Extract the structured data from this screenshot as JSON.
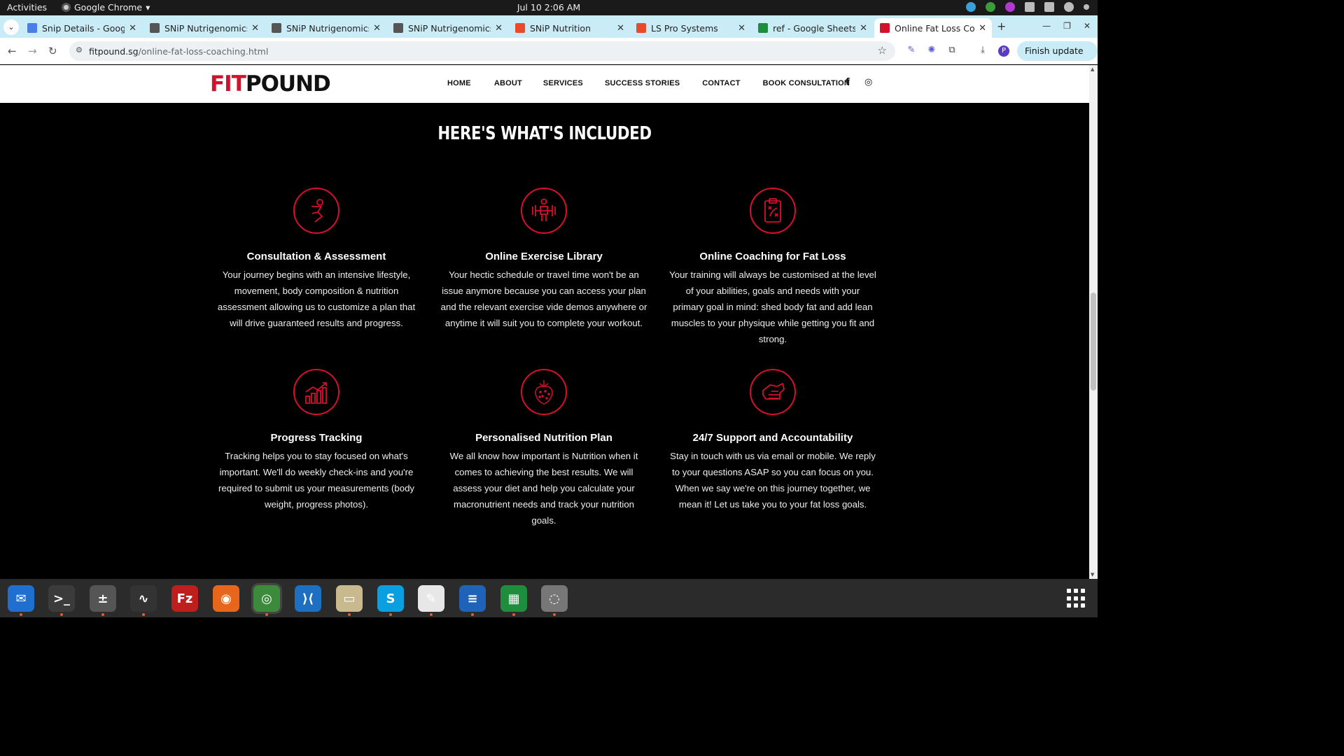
{
  "system": {
    "activities": "Activities",
    "app_name": "Google Chrome",
    "clock": "Jul 10  2:06 AM"
  },
  "tabs": [
    {
      "title": "Snip Details - Google",
      "favicon_color": "#4a7ee8",
      "active": false
    },
    {
      "title": "SNiP Nutrigenomics",
      "favicon_color": "#555555",
      "active": false
    },
    {
      "title": "SNiP Nutrigenomics",
      "favicon_color": "#555555",
      "active": false
    },
    {
      "title": "SNiP Nutrigenomics",
      "favicon_color": "#555555",
      "active": false
    },
    {
      "title": "SNiP Nutrition",
      "favicon_color": "#e84a2a",
      "active": false
    },
    {
      "title": "LS Pro Systems",
      "favicon_color": "#e84a2a",
      "active": false
    },
    {
      "title": "ref - Google Sheets",
      "favicon_color": "#1e8e3e",
      "active": false
    },
    {
      "title": "Online Fat Loss Coac",
      "favicon_color": "#d4102a",
      "active": true
    }
  ],
  "address_bar": {
    "url_host": "fitpound.sg",
    "url_path": "/online-fat-loss-coaching.html",
    "finish_update": "Finish update",
    "profile_initial": "P"
  },
  "site": {
    "logo_fit": "FIT",
    "logo_pound": "POUND",
    "nav": [
      "HOME",
      "ABOUT",
      "SERVICES",
      "SUCCESS STORIES",
      "CONTACT",
      "BOOK CONSULTATION"
    ],
    "social": {
      "facebook": "f",
      "instagram": "◎"
    },
    "accent_color": "#d4102a",
    "section_title": "HERE'S WHAT'S INCLUDED",
    "features": [
      {
        "icon": "stretching-person-icon",
        "title": "Consultation & Assessment",
        "text": "Your journey begins with an intensive lifestyle, movement, body composition & nutrition assessment allowing us to customize a plan that will drive guaranteed results and progress."
      },
      {
        "icon": "weightlifter-icon",
        "title": "Online Exercise Library",
        "text": "Your hectic schedule or travel time won't be an issue anymore because you can access your plan and the relevant exercise vide demos anywhere or anytime it will suit you to complete your workout."
      },
      {
        "icon": "clipboard-strategy-icon",
        "title": "Online Coaching for Fat Loss",
        "text": "Your training will always be customised at the level of your abilities, goals and needs with your primary goal in mind: shed body fat and add lean muscles to your physique while getting you fit and strong."
      },
      {
        "icon": "bar-chart-icon",
        "title": "Progress Tracking",
        "text": "Tracking helps you to stay focused on what's important. We'll do weekly check-ins and you're required to submit us your measurements (body weight, progress photos)."
      },
      {
        "icon": "strawberry-icon",
        "title": "Personalised Nutrition Plan",
        "text": "We all know how important is Nutrition when it comes to achieving the best results. We will assess your diet and help you calculate your macronutrient needs and track your nutrition goals."
      },
      {
        "icon": "fist-icon",
        "title": "24/7 Support and Accountability",
        "text": "Stay in touch with us via email or mobile. We reply to your questions ASAP so you can focus on you. When we say we're on this journey together, we mean it! Let us take you to your fat loss goals."
      }
    ]
  },
  "dock": [
    {
      "name": "thunderbird-icon",
      "color": "#1f6fd1",
      "glyph": "✉"
    },
    {
      "name": "terminal-icon",
      "color": "#3b3b3b",
      "glyph": ">_"
    },
    {
      "name": "calculator-icon",
      "color": "#555555",
      "glyph": "±"
    },
    {
      "name": "system-monitor-icon",
      "color": "#333333",
      "glyph": "∿"
    },
    {
      "name": "filezilla-icon",
      "color": "#bf1e1e",
      "glyph": "Fz"
    },
    {
      "name": "firefox-icon",
      "color": "#e8661c",
      "glyph": "◉"
    },
    {
      "name": "chrome-icon",
      "color": "#3c8b3c",
      "glyph": "◎"
    },
    {
      "name": "vscode-icon",
      "color": "#1d6fc2",
      "glyph": "⟩⟨"
    },
    {
      "name": "files-icon",
      "color": "#c9b98f",
      "glyph": "▭"
    },
    {
      "name": "skype-icon",
      "color": "#0a9fe0",
      "glyph": "S"
    },
    {
      "name": "text-editor-icon",
      "color": "#e7e7e7",
      "glyph": "✎"
    },
    {
      "name": "writer-icon",
      "color": "#1f63b8",
      "glyph": "≡"
    },
    {
      "name": "calc-icon",
      "color": "#1e8e3e",
      "glyph": "▦"
    },
    {
      "name": "disc-icon",
      "color": "#777777",
      "glyph": "◌"
    }
  ]
}
